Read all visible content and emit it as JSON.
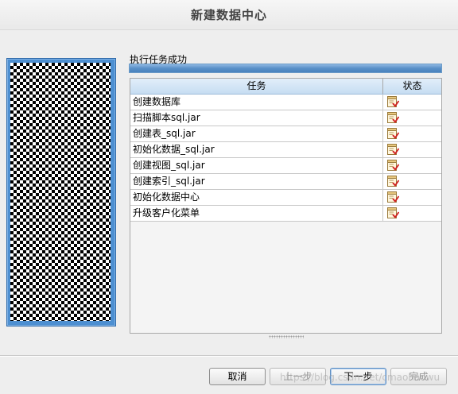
{
  "window": {
    "title": "新建数据中心"
  },
  "status": {
    "message": "执行任务成功",
    "progress_fraction": 1.0
  },
  "table": {
    "headers": {
      "task": "任务",
      "status": "状态"
    },
    "rows": [
      {
        "task": "创建数据库",
        "status_icon": "done-checklist-icon"
      },
      {
        "task": "扫描脚本sql.jar",
        "status_icon": "done-checklist-icon"
      },
      {
        "task": "创建表_sql.jar",
        "status_icon": "done-checklist-icon"
      },
      {
        "task": "初始化数据_sql.jar",
        "status_icon": "done-checklist-icon"
      },
      {
        "task": "创建视图_sql.jar",
        "status_icon": "done-checklist-icon"
      },
      {
        "task": "创建索引_sql.jar",
        "status_icon": "done-checklist-icon"
      },
      {
        "task": "初始化数据中心",
        "status_icon": "done-checklist-icon"
      },
      {
        "task": "升级客户化菜单",
        "status_icon": "done-checklist-icon"
      }
    ]
  },
  "buttons": {
    "cancel": "取消",
    "back": "上一步",
    "next": "下一步",
    "finish": "完成"
  },
  "watermark": "https://blog.csdn.net/cmaohaowu",
  "colors": {
    "accent": "#4d8fd1",
    "progress": "#5890c8",
    "header_row": "#c6ddf2"
  }
}
